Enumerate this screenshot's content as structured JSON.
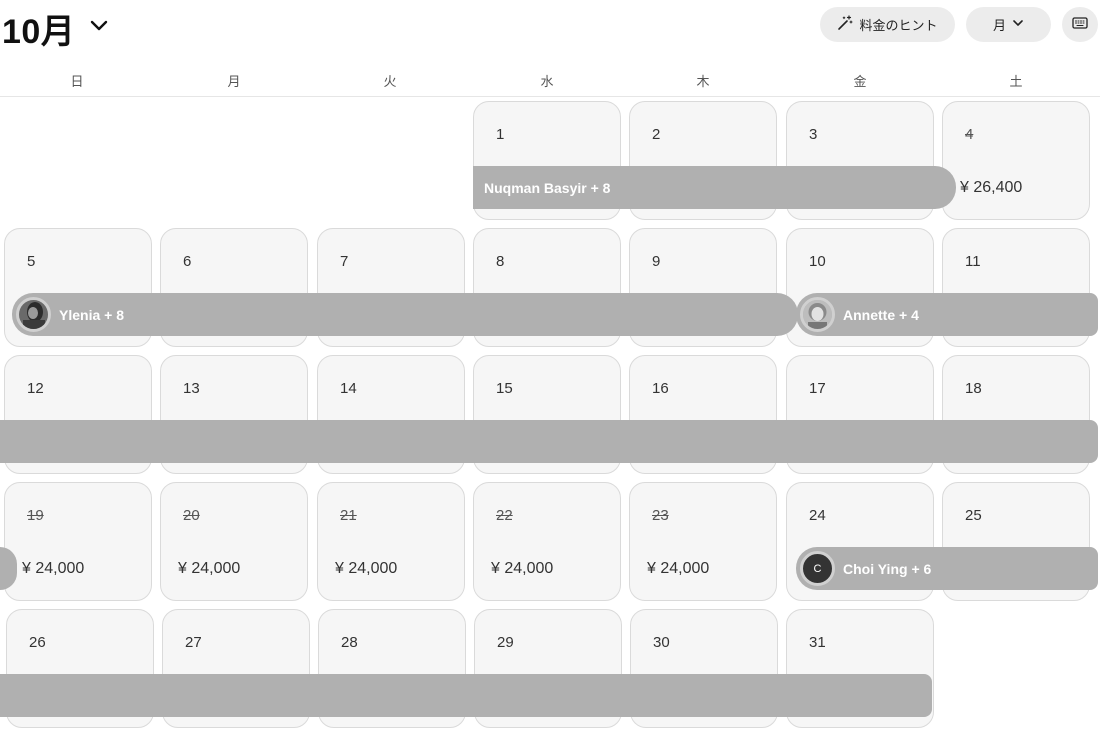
{
  "header": {
    "month_title": "10月",
    "hint_button_label": "料金のヒント",
    "view_button_label": "月"
  },
  "weekdays": [
    "日",
    "月",
    "火",
    "水",
    "木",
    "金",
    "土"
  ],
  "weeks": [
    [
      null,
      null,
      null,
      {
        "day": "1"
      },
      {
        "day": "2"
      },
      {
        "day": "3"
      },
      {
        "day": "4",
        "blocked": true,
        "price": "¥ 26,400"
      }
    ],
    [
      {
        "day": "5"
      },
      {
        "day": "6"
      },
      {
        "day": "7"
      },
      {
        "day": "8"
      },
      {
        "day": "9"
      },
      {
        "day": "10"
      },
      {
        "day": "11"
      }
    ],
    [
      {
        "day": "12"
      },
      {
        "day": "13"
      },
      {
        "day": "14"
      },
      {
        "day": "15"
      },
      {
        "day": "16"
      },
      {
        "day": "17"
      },
      {
        "day": "18"
      }
    ],
    [
      {
        "day": "19",
        "blocked": true,
        "price": "¥ 24,000"
      },
      {
        "day": "20",
        "blocked": true,
        "price": "¥ 24,000"
      },
      {
        "day": "21",
        "blocked": true,
        "price": "¥ 24,000"
      },
      {
        "day": "22",
        "blocked": true,
        "price": "¥ 24,000"
      },
      {
        "day": "23",
        "blocked": true,
        "price": "¥ 24,000"
      },
      {
        "day": "24"
      },
      {
        "day": "25"
      }
    ],
    [
      {
        "day": "26"
      },
      {
        "day": "27"
      },
      {
        "day": "28"
      },
      {
        "day": "29"
      },
      {
        "day": "30"
      },
      {
        "day": "31"
      },
      null
    ]
  ],
  "reservations": [
    {
      "guest_label": "Nuqman Basyir + 8",
      "avatar": "none"
    },
    {
      "guest_label": "Ylenia + 8",
      "avatar": "photo"
    },
    {
      "guest_label": "Annette + 4",
      "avatar": "photo"
    },
    {
      "guest_label": "",
      "avatar": "none"
    },
    {
      "guest_label": "",
      "avatar": "none"
    },
    {
      "guest_label": "Choi Ying + 6",
      "avatar": "letter",
      "avatar_letter": "C"
    },
    {
      "guest_label": "",
      "avatar": "none"
    }
  ],
  "colors": {
    "reservation_bar": "#b0b0b0",
    "cell_background": "#f6f6f6",
    "cell_border": "#dadada"
  },
  "icons": {
    "month_dropdown": "chevron-down-icon",
    "hint": "magic-wand-icon",
    "view_dropdown": "chevron-down-icon",
    "keyboard": "keyboard-icon"
  }
}
